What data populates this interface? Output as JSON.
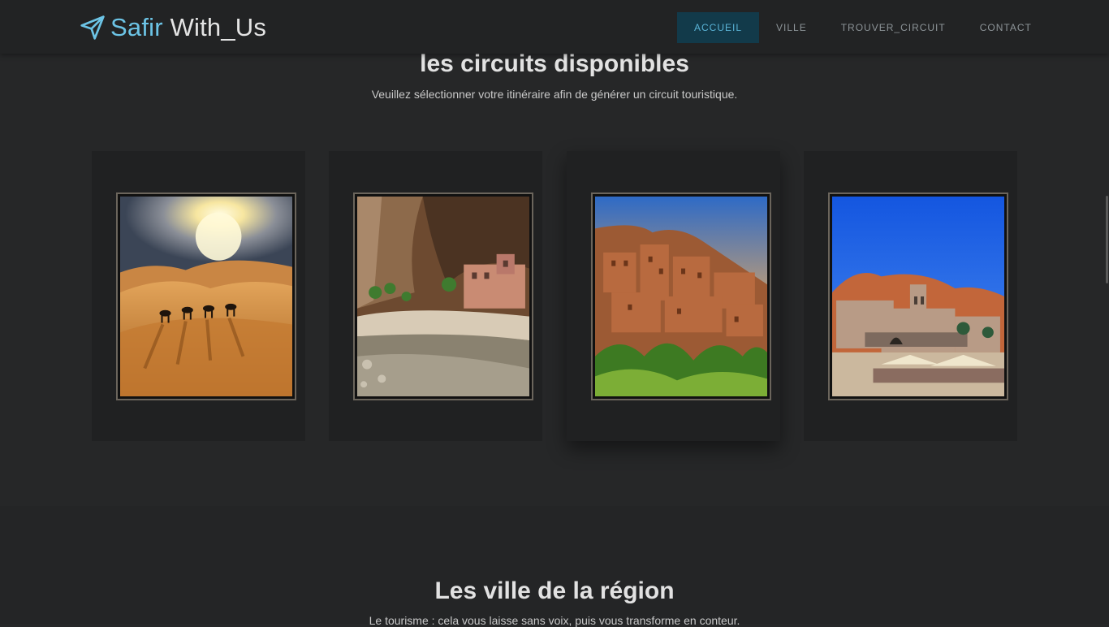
{
  "navbar": {
    "brand_accent": "Safir",
    "brand_rest": " With_Us",
    "brand_icon": "paper-plane-icon",
    "links": [
      {
        "label": "ACCUEIL",
        "active": true
      },
      {
        "label": "VILLE",
        "active": false
      },
      {
        "label": "TROUVER_CIRCUIT",
        "active": false
      },
      {
        "label": "CONTACT",
        "active": false
      }
    ]
  },
  "circuits": {
    "title": "les circuits disponibles",
    "subtitle": "Veuillez sélectionner votre itinéraire afin de générer un circuit touristique."
  },
  "cities": {
    "title": "Les ville de la région",
    "subtitle": "Le tourisme : cela vous laisse sans voix, puis vous transforme en conteur."
  },
  "colors": {
    "background": "#262728",
    "navbar": "#222324",
    "accent": "#6cc4e6",
    "active_nav": "#123a4a"
  }
}
